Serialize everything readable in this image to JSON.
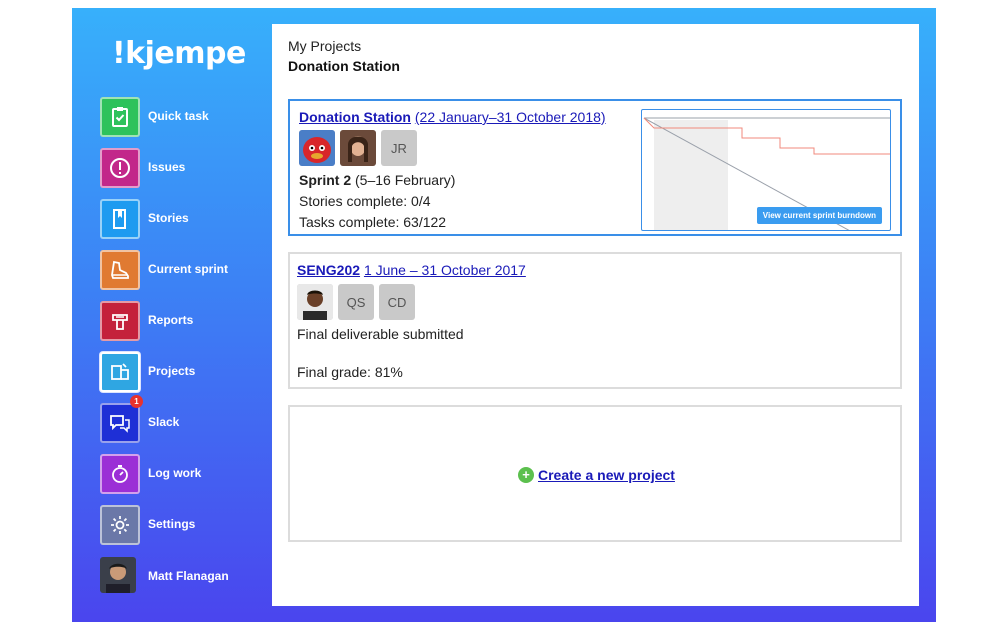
{
  "app": {
    "logo": "!kjempe"
  },
  "sidebar": {
    "items": [
      {
        "label": "Quick task",
        "icon": "clipboard-check-icon",
        "color": "#2ec25b"
      },
      {
        "label": "Issues",
        "icon": "alert-circle-icon",
        "color": "#c2278a"
      },
      {
        "label": "Stories",
        "icon": "book-icon",
        "color": "#1e9bf0"
      },
      {
        "label": "Current sprint",
        "icon": "sneaker-icon",
        "color": "#e07a32"
      },
      {
        "label": "Reports",
        "icon": "megaphone-icon",
        "color": "#c4213b"
      },
      {
        "label": "Projects",
        "icon": "projects-icon",
        "color": "#2fa6e2"
      },
      {
        "label": "Slack",
        "icon": "chat-bubbles-icon",
        "color": "#1e2fd6",
        "badge": "1"
      },
      {
        "label": "Log work",
        "icon": "stopwatch-icon",
        "color": "#9b2fd6"
      },
      {
        "label": "Settings",
        "icon": "gear-icon",
        "color": "#6b78a8"
      }
    ],
    "user": {
      "name": "Matt Flanagan"
    }
  },
  "header": {
    "breadcrumb": "My Projects",
    "title": "Donation Station"
  },
  "projects": [
    {
      "name": "Donation Station",
      "dates": "(22 January–31 October 2018)",
      "members": [
        "",
        "",
        "JR"
      ],
      "sprint_label": "Sprint 2",
      "sprint_dates": "(5–16 February)",
      "stories": "Stories complete: 0/4",
      "tasks": "Tasks complete: 63/122",
      "burndown_button": "View current sprint burndown"
    },
    {
      "name": "SENG202",
      "dates": "1 June – 31 October 2017",
      "members": [
        "",
        "QS",
        "CD"
      ],
      "status": "Final deliverable submitted",
      "grade": "Final grade: 81%"
    }
  ],
  "create": {
    "label": "Create a new project"
  }
}
